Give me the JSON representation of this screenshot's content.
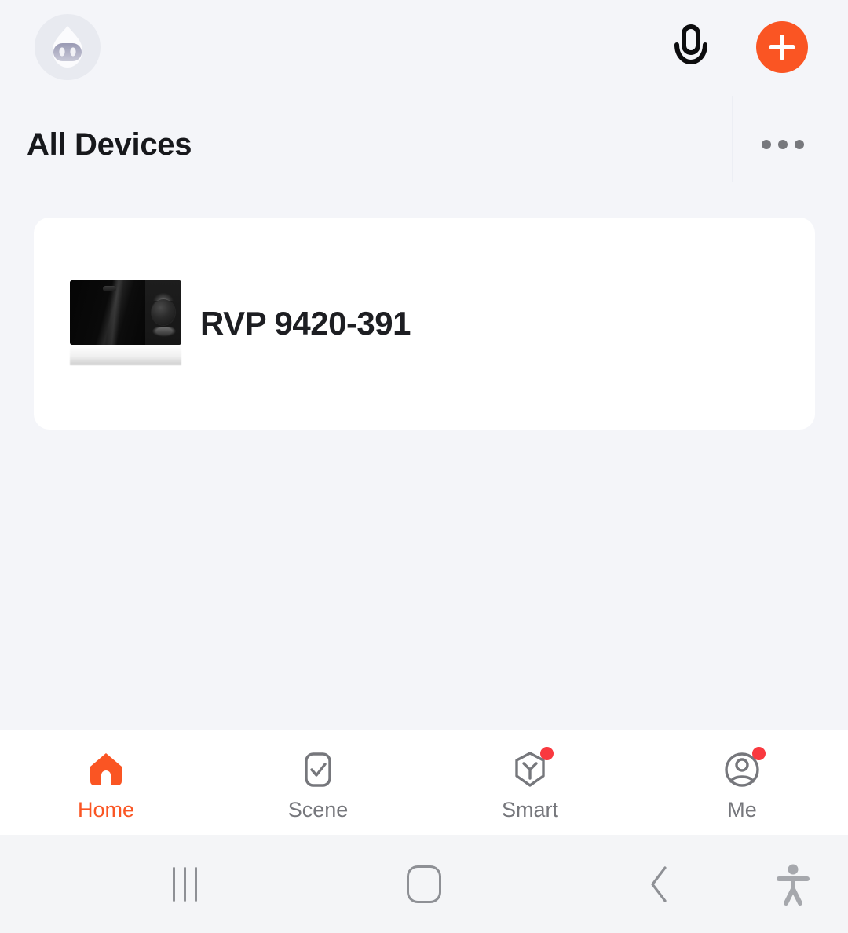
{
  "header": {
    "avatar_icon": "avatar-icon",
    "mic_icon": "microphone-icon",
    "add_icon": "plus-icon",
    "more_icon": "more-options-icon"
  },
  "page": {
    "title": "All Devices"
  },
  "devices": [
    {
      "name": "RVP 9420-391",
      "thumbnail_icon": "microwave-device-image"
    }
  ],
  "tabs": [
    {
      "label": "Home",
      "icon": "home-icon",
      "active": true,
      "badge": false
    },
    {
      "label": "Scene",
      "icon": "scene-icon",
      "active": false,
      "badge": false
    },
    {
      "label": "Smart",
      "icon": "smart-icon",
      "active": false,
      "badge": true
    },
    {
      "label": "Me",
      "icon": "profile-icon",
      "active": false,
      "badge": true
    }
  ],
  "system_nav": {
    "recents_icon": "recents-icon",
    "home_icon": "home-square-icon",
    "back_icon": "back-chevron-icon",
    "accessibility_icon": "accessibility-icon"
  },
  "colors": {
    "accent": "#fa5523",
    "badge": "#f9393f",
    "background": "#f4f5f9",
    "card": "#ffffff",
    "text_primary": "#17181c",
    "text_muted": "#76777c"
  }
}
